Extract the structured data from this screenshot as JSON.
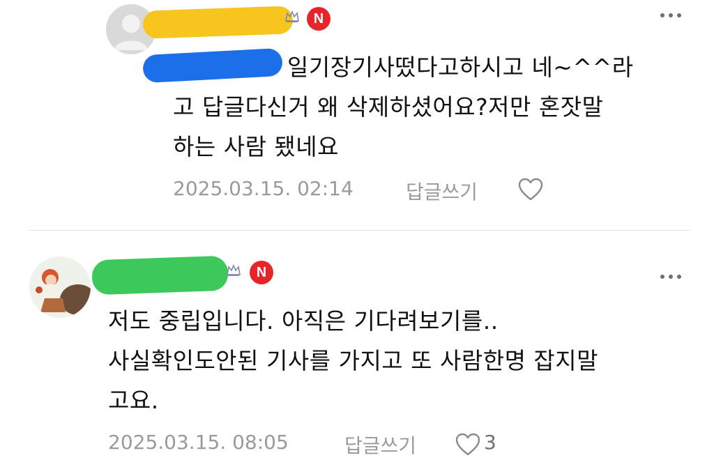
{
  "comments": [
    {
      "badge": "N",
      "mention": "^",
      "text_lines": [
        "일기장기사떴다고하시고 네~^^라",
        "고 답글다신거 왜 삭제하셨어요?저만 혼잣말",
        "하는 사람 됐네요"
      ],
      "timestamp": "2025.03.15. 02:14",
      "reply_label": "답글쓰기",
      "like_count": ""
    },
    {
      "badge": "N",
      "text_lines": [
        "저도 중립입니다. 아직은 기다려보기를..",
        "사실확인도안된 기사를 가지고 또 사람한명 잡지말",
        "고요."
      ],
      "timestamp": "2025.03.15. 08:05",
      "reply_label": "답글쓰기",
      "like_count": "3"
    }
  ],
  "colors": {
    "badge_red": "#e8242b",
    "redact_yellow": "#f7c51e",
    "redact_blue": "#1d6fe9",
    "redact_green": "#3cc85a",
    "meta_gray": "#9a9a9a"
  },
  "icons": [
    "more-options-icon",
    "heart-icon",
    "crown-icon",
    "default-avatar-icon"
  ]
}
